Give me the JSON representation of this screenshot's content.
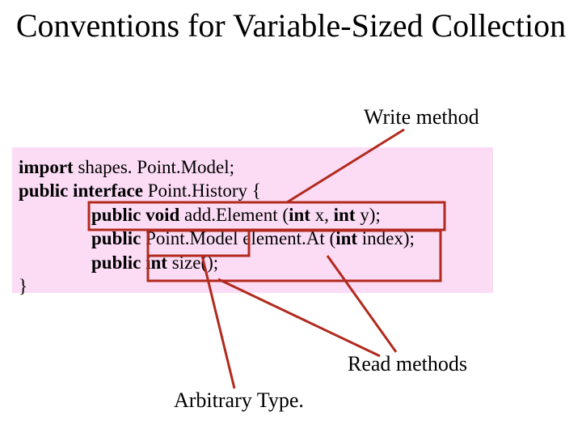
{
  "title": "Conventions for Variable-Sized Collection",
  "labels": {
    "write": "Write method",
    "read": "Read methods",
    "arbtype": "Arbitrary Type."
  },
  "code": {
    "kw_import": "import",
    "import_rest": " shapes. Point.Model;",
    "kw_public1": "public interface",
    "iface_rest": " Point.History {",
    "kw_m1a": "public void",
    "m1_mid": " add.Element (",
    "kw_m1b": "int",
    "m1_x": " x, ",
    "kw_m1c": "int",
    "m1_y": " y);",
    "kw_m2a": "public",
    "m2_type": " Point.Model element.At (",
    "kw_m2b": "int",
    "m2_rest": " index);",
    "kw_m3a": "public int",
    "m3_rest": " size();",
    "close": "}"
  }
}
